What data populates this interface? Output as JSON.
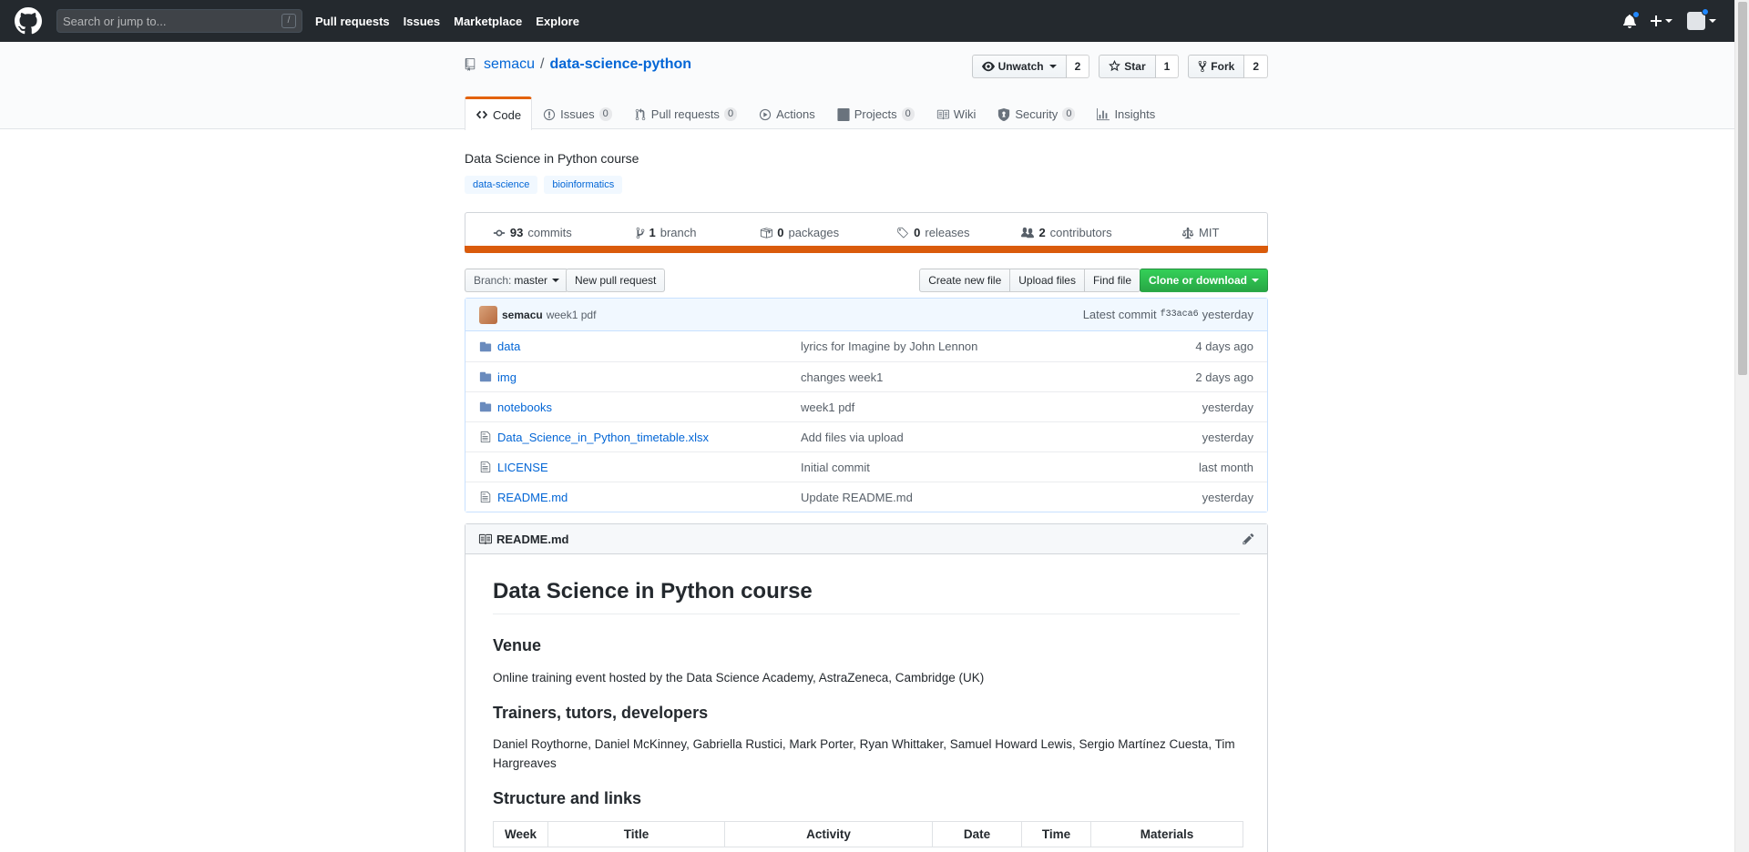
{
  "header": {
    "search_placeholder": "Search or jump to...",
    "search_shortcut": "/",
    "nav": [
      "Pull requests",
      "Issues",
      "Marketplace",
      "Explore"
    ]
  },
  "repo": {
    "owner": "semacu",
    "separator": "/",
    "name": "data-science-python",
    "watch_label": "Unwatch",
    "watch_count": "2",
    "star_label": "Star",
    "star_count": "1",
    "fork_label": "Fork",
    "fork_count": "2"
  },
  "tabs": [
    {
      "label": "Code",
      "count": "",
      "icon": "code-icon"
    },
    {
      "label": "Issues",
      "count": "0",
      "icon": "issue-icon"
    },
    {
      "label": "Pull requests",
      "count": "0",
      "icon": "pull-request-icon"
    },
    {
      "label": "Actions",
      "count": "",
      "icon": "play-icon"
    },
    {
      "label": "Projects",
      "count": "0",
      "icon": "project-icon"
    },
    {
      "label": "Wiki",
      "count": "",
      "icon": "book-icon"
    },
    {
      "label": "Security",
      "count": "0",
      "icon": "shield-icon"
    },
    {
      "label": "Insights",
      "count": "",
      "icon": "graph-icon"
    }
  ],
  "description": "Data Science in Python course",
  "topics": [
    "data-science",
    "bioinformatics"
  ],
  "summary": {
    "commits_num": "93",
    "commits_label": "commits",
    "branch_num": "1",
    "branch_label": "branch",
    "packages_num": "0",
    "packages_label": "packages",
    "releases_num": "0",
    "releases_label": "releases",
    "contributors_num": "2",
    "contributors_label": "contributors",
    "license": "MIT"
  },
  "language_color": "#DA5B0B",
  "filenav": {
    "branch_prefix": "Branch:",
    "branch_name": "master",
    "new_pr": "New pull request",
    "create_file": "Create new file",
    "upload_files": "Upload files",
    "find_file": "Find file",
    "clone": "Clone or download"
  },
  "latest_commit": {
    "author": "semacu",
    "message": "week1 pdf",
    "label": "Latest commit",
    "sha": "f33aca6",
    "age": "yesterday"
  },
  "files": [
    {
      "type": "dir",
      "name": "data",
      "message": "lyrics for Imagine by John Lennon",
      "age": "4 days ago"
    },
    {
      "type": "dir",
      "name": "img",
      "message": "changes week1",
      "age": "2 days ago"
    },
    {
      "type": "dir",
      "name": "notebooks",
      "message": "week1 pdf",
      "age": "yesterday"
    },
    {
      "type": "file",
      "name": "Data_Science_in_Python_timetable.xlsx",
      "message": "Add files via upload",
      "age": "yesterday"
    },
    {
      "type": "file",
      "name": "LICENSE",
      "message": "Initial commit",
      "age": "last month"
    },
    {
      "type": "file",
      "name": "README.md",
      "message": "Update README.md",
      "age": "yesterday"
    }
  ],
  "readme": {
    "filename": "README.md",
    "h1": "Data Science in Python course",
    "venue_heading": "Venue",
    "venue_text": "Online training event hosted by the Data Science Academy, AstraZeneca, Cambridge (UK)",
    "trainers_heading": "Trainers, tutors, developers",
    "trainers_text": "Daniel Roythorne, Daniel McKinney, Gabriella Rustici, Mark Porter, Ryan Whittaker, Samuel Howard Lewis, Sergio Martínez Cuesta, Tim Hargreaves",
    "structure_heading": "Structure and links",
    "table_headers": [
      "Week",
      "Title",
      "Activity",
      "Date",
      "Time",
      "Materials"
    ]
  }
}
